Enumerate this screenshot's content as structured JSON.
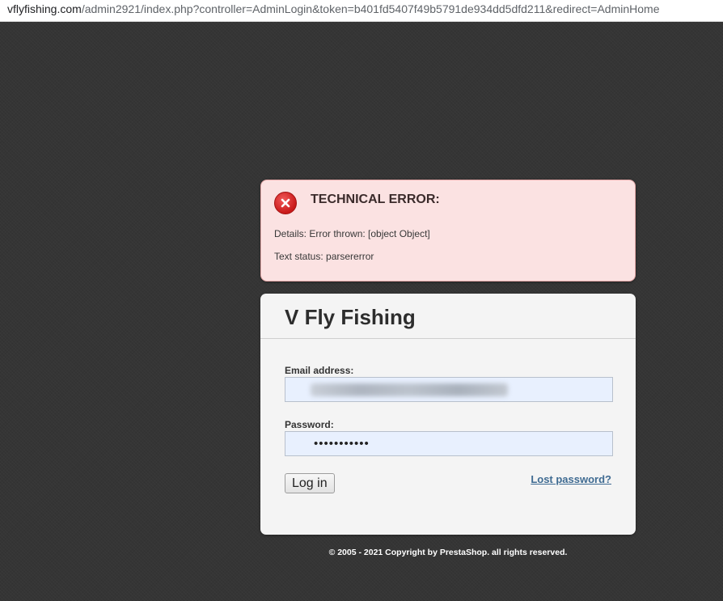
{
  "browser": {
    "url_domain": "vflyfishing.com",
    "url_path": "/admin2921/index.php?controller=AdminLogin&token=b401fd5407f49b5791de934dd5dfd211&redirect=AdminHome"
  },
  "error": {
    "icon": "error-x-icon",
    "title": "TECHNICAL ERROR:",
    "details": "Details: Error thrown: [object Object]",
    "status": "Text status: parsererror"
  },
  "login": {
    "shop_name": "V Fly Fishing",
    "email_label": "Email address:",
    "email_value": "",
    "password_label": "Password:",
    "password_value": "•••••••••••",
    "button_label": "Log in",
    "lost_password_label": "Lost password?"
  },
  "footer": {
    "text": "© 2005 - 2021 Copyright by PrestaShop. all rights reserved."
  },
  "colors": {
    "background": "#353535",
    "error_bg": "#fbe2e2",
    "error_icon": "#d32020",
    "card_bg": "#f4f4f4",
    "input_bg": "#e8f0fe",
    "link": "#3f6b92"
  }
}
